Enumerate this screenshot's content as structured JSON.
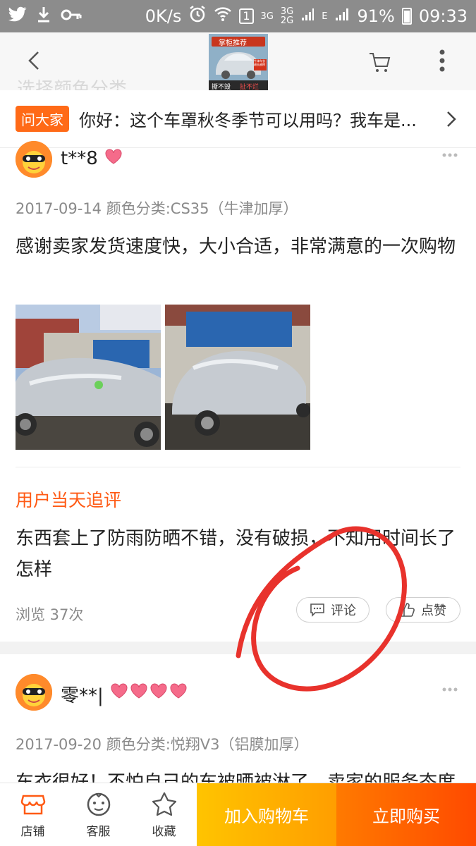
{
  "status_bar": {
    "network_speed": "0K/s",
    "sim_badge": "1",
    "net_type_1": "3G",
    "net_type_2a": "3G",
    "net_type_2b": "2G",
    "edge": "E",
    "battery": "91%",
    "time": "09:33"
  },
  "nav": {
    "thumb_top_label": "掌柜推荐",
    "thumb_bottom_left": "撕不毁",
    "thumb_bottom_right": "扯不烂",
    "thumb_side_label": "牛津车衣 越长越擦",
    "ghost_text": "选择颜色分类"
  },
  "ask": {
    "badge": "问大家",
    "question": "你好：这个车罩秋冬季节可以用吗？我车是..."
  },
  "review1": {
    "username": "t**8",
    "meta": "2017-09-14 颜色分类:CS35（牛津加厚）",
    "content": "感谢卖家发货速度快，大小合适，非常满意的一次购物",
    "followup_title": "用户当天追评",
    "followup_content": "东西套上了防雨防晒不错，没有破损，不知用时间长了怎样",
    "views": "浏览 37次",
    "comment_label": "评论",
    "like_label": "点赞"
  },
  "review2": {
    "username": "零**|",
    "meta": "2017-09-20 颜色分类:悦翔V3（铝膜加厚）",
    "content": "车衣很好！不怕自己的车被晒被淋了，卖家的服务态度"
  },
  "tabbar": {
    "shop": "店铺",
    "service": "客服",
    "favorite": "收藏",
    "add_to_cart": "加入购物车",
    "buy_now": "立即购买"
  },
  "colors": {
    "accent": "#ff5a14",
    "cart_button": "#ffb000",
    "buy_button": "#ff5a00",
    "annotation": "#e8322c"
  }
}
